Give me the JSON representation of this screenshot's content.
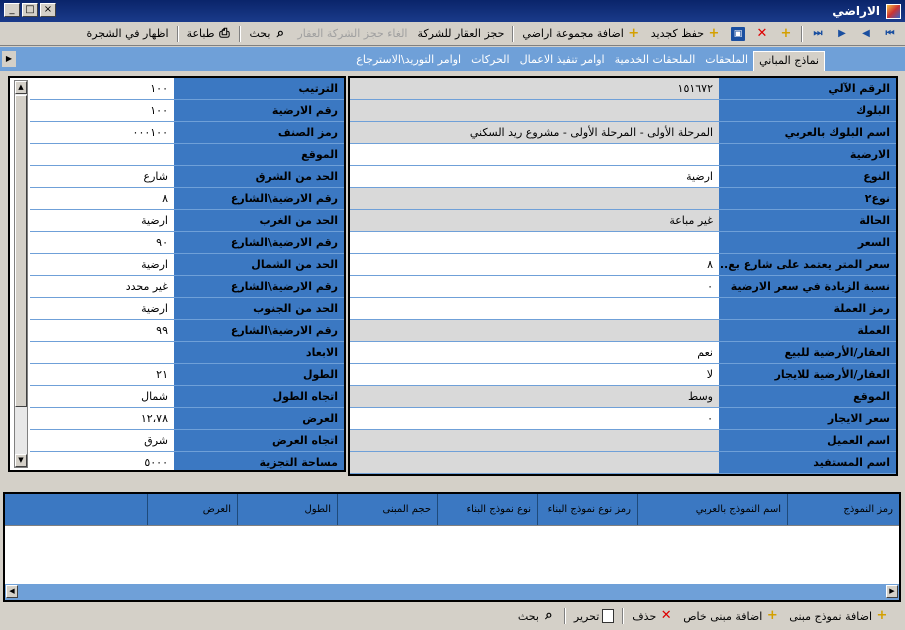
{
  "window": {
    "title": "الاراضي"
  },
  "toolbar": {
    "save_new": "حفظ كجديد",
    "add_group": "اضافة مجموعة اراضي",
    "book_company": "حجز العقار للشركة",
    "cancel_booking": "الغاء حجز الشركة العقار",
    "search": "بحث",
    "print": "طباعة",
    "show_tree": "اظهار في الشجرة"
  },
  "tabs": [
    "نماذج المباني",
    "الملحقات",
    "الملحقات الخدمية",
    "اوامر تنفيذ الاعمال",
    "الحركات",
    "اوامر التوريد\\الاسترجاع"
  ],
  "right_fields": [
    {
      "label": "الرقم الآلي",
      "value": "١٥١٦٧٢",
      "style": "gray"
    },
    {
      "label": "البلوك",
      "value": "",
      "style": "gray"
    },
    {
      "label": "اسم البلوك بالعربي",
      "value": "المرحلة الأولى - المرحلة الأولى - مشروع ريد السكني",
      "style": "gray"
    },
    {
      "label": "الارضية",
      "value": "",
      "style": "section"
    },
    {
      "label": "النوع",
      "value": "ارضية",
      "style": "white"
    },
    {
      "label": "نوع٢",
      "value": "",
      "style": "gray"
    },
    {
      "label": "الحالة",
      "value": "غير مباعة",
      "style": "gray"
    },
    {
      "label": "السعر",
      "value": "",
      "style": "section"
    },
    {
      "label": "سعر المتر يعتمد على شارع بع...",
      "value": "٨",
      "style": "white"
    },
    {
      "label": "نسبة الزيادة في سعر الارضية",
      "value": "٠",
      "style": "white"
    },
    {
      "label": "رمز العملة",
      "value": "",
      "style": "white"
    },
    {
      "label": "العملة",
      "value": "",
      "style": "gray"
    },
    {
      "label": "العقار/الأرضية للبيع",
      "value": "نعم",
      "style": "white"
    },
    {
      "label": "العقار/الأرضية للايجار",
      "value": "لا",
      "style": "white"
    },
    {
      "label": "الموقع",
      "value": "وسط",
      "style": "gray"
    },
    {
      "label": "سعر الايجار",
      "value": "٠",
      "style": "white"
    },
    {
      "label": "اسم العميل",
      "value": "",
      "style": "gray"
    },
    {
      "label": "اسم المستفيد",
      "value": "",
      "style": "gray"
    }
  ],
  "left_fields": [
    {
      "label": "الترتيب",
      "value": "١٠٠",
      "style": "white"
    },
    {
      "label": "رقم الارضية",
      "value": "١٠٠",
      "style": "white"
    },
    {
      "label": "رمز الصنف",
      "value": "٠٠٠١٠٠",
      "style": "white"
    },
    {
      "label": "الموقع",
      "value": "",
      "style": "section"
    },
    {
      "label": "الحد من الشرق",
      "value": "شارع",
      "style": "white"
    },
    {
      "label": "رقم الارضية\\الشارع",
      "value": "٨",
      "style": "white"
    },
    {
      "label": "الحد من الغرب",
      "value": "ارضية",
      "style": "white"
    },
    {
      "label": "رقم الارضية\\الشارع",
      "value": "٩٠",
      "style": "white"
    },
    {
      "label": "الحد من الشمال",
      "value": "ارضية",
      "style": "white"
    },
    {
      "label": "رقم الارضية\\الشارع",
      "value": "غير محدد",
      "style": "white"
    },
    {
      "label": "الحد من الجنوب",
      "value": "ارضية",
      "style": "white"
    },
    {
      "label": "رقم الارضية\\الشارع",
      "value": "٩٩",
      "style": "white"
    },
    {
      "label": "الابعاد",
      "value": "",
      "style": "section"
    },
    {
      "label": "الطول",
      "value": "٢١",
      "style": "white"
    },
    {
      "label": "اتجاه الطول",
      "value": "شمال",
      "style": "white"
    },
    {
      "label": "العرض",
      "value": "١٢،٧٨",
      "style": "white"
    },
    {
      "label": "اتجاه العرض",
      "value": "شرق",
      "style": "white"
    },
    {
      "label": "مساحة التجزية",
      "value": "٥٠٠٠",
      "style": "white"
    }
  ],
  "grid": {
    "columns": [
      "رمز النموذج",
      "اسم النموذج بالعربي",
      "رمز نوع نموذج البناء",
      "نوع نموذج البناء",
      "حجم المبنى",
      "الطول",
      "العرض"
    ]
  },
  "bottombar": {
    "add_model": "اضافة نموذج مبنى",
    "add_private": "اضافة مبنى خاص",
    "delete": "حذف",
    "edit": "تحرير",
    "search": "بحث"
  },
  "colors": {
    "label_bg": "#3b78c2",
    "tab_bar": "#6fa0d8",
    "title_bar": "#0a246a"
  }
}
